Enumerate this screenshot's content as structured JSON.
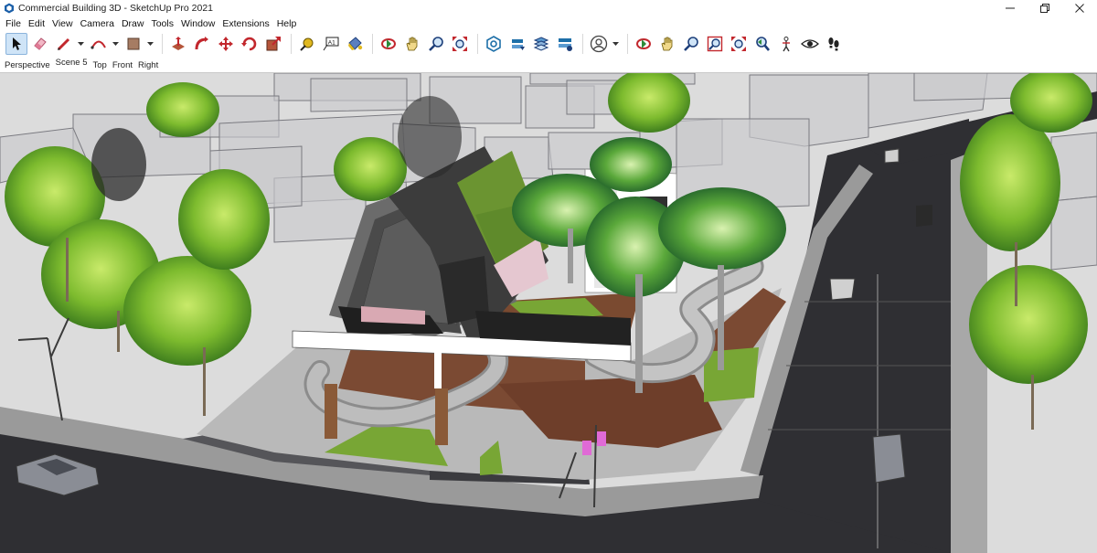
{
  "window": {
    "title": "Commercial Building 3D - SketchUp Pro 2021"
  },
  "menu": {
    "items": [
      "File",
      "Edit",
      "View",
      "Camera",
      "Draw",
      "Tools",
      "Window",
      "Extensions",
      "Help"
    ]
  },
  "toolbar": {
    "tools": [
      {
        "icon": "select-arrow-icon"
      },
      {
        "icon": "eraser-icon"
      },
      {
        "icon": "pencil-line-icon"
      },
      {
        "icon": "arc-icon"
      },
      {
        "icon": "rectangle-shape-icon"
      },
      {
        "icon": "push-pull-icon"
      },
      {
        "icon": "follow-me-icon"
      },
      {
        "icon": "move-icon"
      },
      {
        "icon": "rotate-icon"
      },
      {
        "icon": "scale-icon"
      },
      {
        "icon": "tape-measure-icon"
      },
      {
        "icon": "text-label-icon"
      },
      {
        "icon": "paint-bucket-icon"
      },
      {
        "icon": "orbit-icon"
      },
      {
        "icon": "pan-icon"
      },
      {
        "icon": "zoom-icon"
      },
      {
        "icon": "zoom-extents-icon"
      },
      {
        "icon": "3d-warehouse-icon"
      },
      {
        "icon": "extension-warehouse-icon"
      },
      {
        "icon": "layout-icon"
      },
      {
        "icon": "extension-manager-icon"
      },
      {
        "icon": "user-account-icon"
      },
      {
        "icon": "orbit-2-icon"
      },
      {
        "icon": "pan-2-icon"
      },
      {
        "icon": "zoom-2-icon"
      },
      {
        "icon": "zoom-window-icon"
      },
      {
        "icon": "zoom-extents-2-icon"
      },
      {
        "icon": "previous-view-icon"
      },
      {
        "icon": "position-camera-icon"
      },
      {
        "icon": "look-around-icon"
      },
      {
        "icon": "walk-icon"
      }
    ]
  },
  "scenes": {
    "tabs": [
      "Perspective",
      "Scene 5",
      "Top",
      "Front",
      "Right"
    ]
  },
  "text_tool_label": "A1"
}
